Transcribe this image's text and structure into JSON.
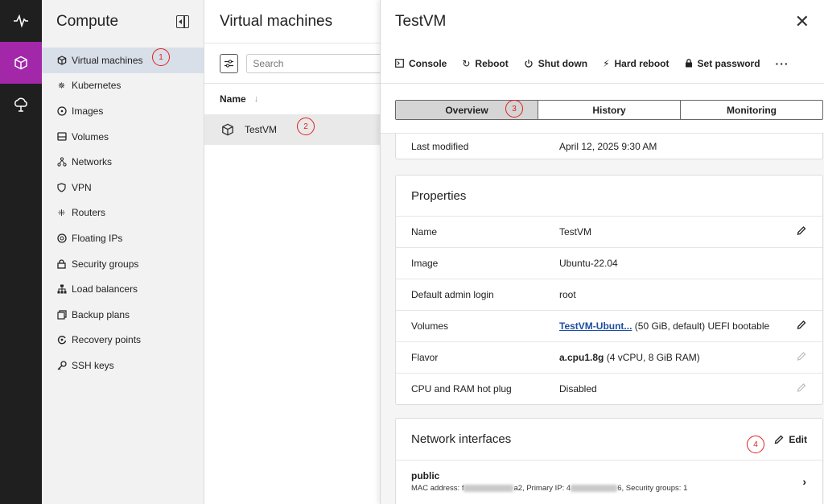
{
  "rail": {
    "items": [
      {
        "icon": "activity-icon",
        "active": false
      },
      {
        "icon": "cube-icon",
        "active": true
      },
      {
        "icon": "cloud-icon",
        "active": false
      }
    ]
  },
  "sidebar": {
    "title": "Compute",
    "items": [
      {
        "label": "Virtual machines",
        "icon": "cube-icon"
      },
      {
        "label": "Kubernetes",
        "icon": "kubernetes-icon"
      },
      {
        "label": "Images",
        "icon": "disc-icon"
      },
      {
        "label": "Volumes",
        "icon": "drive-icon"
      },
      {
        "label": "Networks",
        "icon": "network-icon"
      },
      {
        "label": "VPN",
        "icon": "shield-icon"
      },
      {
        "label": "Routers",
        "icon": "router-icon"
      },
      {
        "label": "Floating IPs",
        "icon": "floating-ip-icon"
      },
      {
        "label": "Security groups",
        "icon": "lock-icon"
      },
      {
        "label": "Load balancers",
        "icon": "load-balancer-icon"
      },
      {
        "label": "Backup plans",
        "icon": "backup-icon"
      },
      {
        "label": "Recovery points",
        "icon": "recovery-icon"
      },
      {
        "label": "SSH keys",
        "icon": "key-icon"
      }
    ]
  },
  "list": {
    "title": "Virtual machines",
    "search_placeholder": "Search",
    "column_name": "Name",
    "rows": [
      {
        "name": "TestVM"
      }
    ]
  },
  "drawer": {
    "title": "TestVM",
    "actions": [
      {
        "label": "Console",
        "icon": "console-icon"
      },
      {
        "label": "Reboot",
        "icon": "reboot-icon"
      },
      {
        "label": "Shut down",
        "icon": "power-icon"
      },
      {
        "label": "Hard reboot",
        "icon": "bolt-icon"
      },
      {
        "label": "Set password",
        "icon": "lock-icon"
      }
    ],
    "more_label": "···",
    "tabs": [
      {
        "label": "Overview",
        "active": true
      },
      {
        "label": "History",
        "active": false
      },
      {
        "label": "Monitoring",
        "active": false
      }
    ],
    "summary": {
      "label": "Last modified",
      "value": "April 12, 2025 9:30 AM"
    },
    "properties": {
      "title": "Properties",
      "rows": [
        {
          "label": "Name",
          "value": "TestVM"
        },
        {
          "label": "Image",
          "value": "Ubuntu-22.04"
        },
        {
          "label": "Default admin login",
          "value": "root"
        },
        {
          "label": "Volumes",
          "link": "TestVM-Ubunt...",
          "value": " (50 GiB, default) UEFI bootable"
        },
        {
          "label": "Flavor",
          "strong": "a.cpu1.8g",
          "value": " (4 vCPU, 8 GiB RAM)"
        },
        {
          "label": "CPU and RAM hot plug",
          "value": "Disabled"
        }
      ]
    },
    "network": {
      "title": "Network interfaces",
      "edit_label": "Edit",
      "interfaces": [
        {
          "name": "public",
          "mac_prefix": "MAC address: f",
          "mac_suffix": "a2, Primary IP: 4",
          "ip_suffix": "6, Security groups: 1"
        }
      ]
    }
  },
  "annotations": [
    "1",
    "2",
    "3",
    "4"
  ],
  "colors": {
    "rail_active": "#a327a9",
    "annotation": "#e02020",
    "link": "#1d4ea0"
  }
}
